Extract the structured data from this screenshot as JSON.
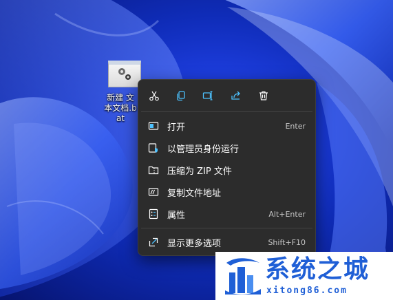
{
  "desktop": {
    "file": {
      "label": "新建 文本文档.bat",
      "icon": "batch-gear-icon"
    }
  },
  "context_menu": {
    "toolbar": [
      {
        "name": "cut",
        "icon": "scissors-icon"
      },
      {
        "name": "copy",
        "icon": "copy-icon"
      },
      {
        "name": "rename",
        "icon": "rename-icon"
      },
      {
        "name": "share",
        "icon": "share-icon"
      },
      {
        "name": "delete",
        "icon": "trash-icon"
      }
    ],
    "items": [
      {
        "label": "打开",
        "shortcut": "Enter",
        "icon": "open-window-icon"
      },
      {
        "label": "以管理员身份运行",
        "shortcut": "",
        "icon": "shield-icon"
      },
      {
        "label": "压缩为 ZIP 文件",
        "shortcut": "",
        "icon": "zip-folder-icon"
      },
      {
        "label": "复制文件地址",
        "shortcut": "",
        "icon": "copy-path-icon"
      },
      {
        "label": "属性",
        "shortcut": "Alt+Enter",
        "icon": "properties-icon"
      },
      {
        "label": "显示更多选项",
        "shortcut": "Shift+F10",
        "icon": "show-more-icon"
      }
    ]
  },
  "watermark": {
    "title": "系统之城",
    "url": "xitong86.com"
  },
  "colors": {
    "menu_bg": "#2c2c2c",
    "accent": "#4cc2ff",
    "watermark_blue": "#1f5fd6"
  }
}
